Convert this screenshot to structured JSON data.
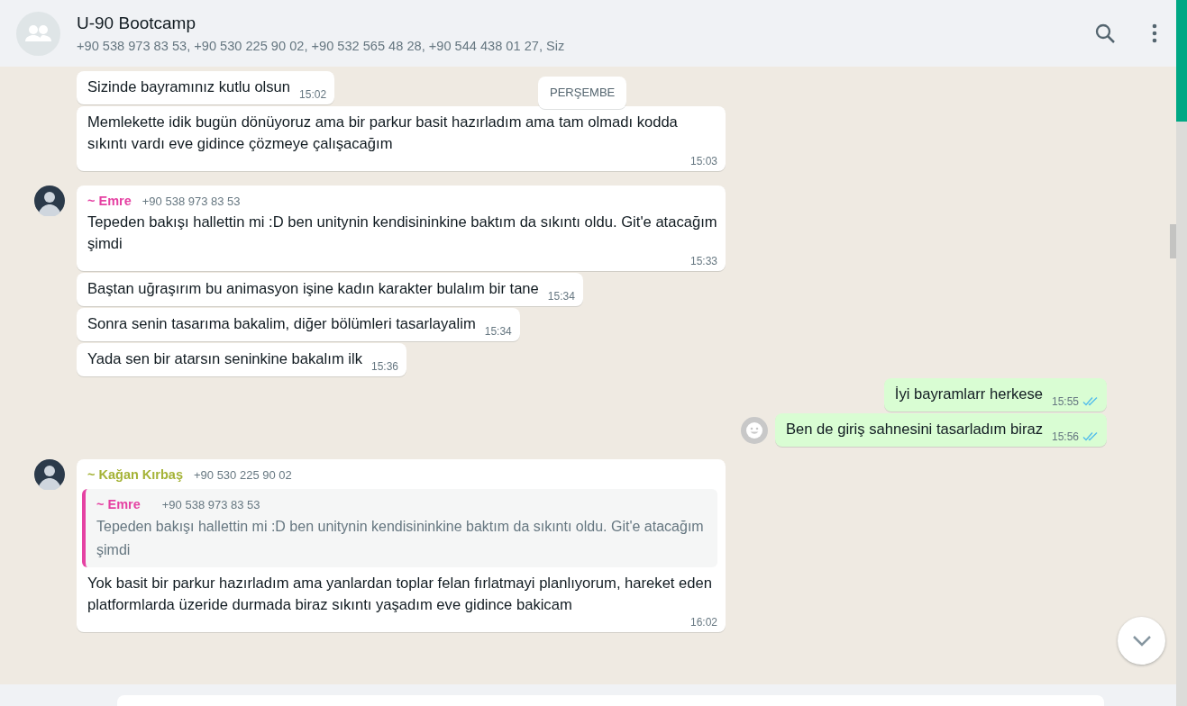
{
  "header": {
    "title": "U-90 Bootcamp",
    "members": "+90 538 973 83 53, +90 530 225 90 02, +90 532 565 48 28, +90 544 438 01 27, Siz"
  },
  "date_chip": "PERŞEMBE",
  "messages": [
    {
      "kind": "in",
      "text": "Sizinde bayramınız kutlu olsun",
      "time": "15:02"
    },
    {
      "kind": "in",
      "text": "Memlekette idik bugün dönüyoruz ama bir parkur basit hazırladım ama tam olmadı kodda sıkıntı vardı eve gidince çözmeye çalışacağım",
      "time": "15:03"
    },
    {
      "kind": "in",
      "sender": "~ Emre",
      "phone": "+90 538 973 83 53",
      "color": "#e542a3",
      "avatar": true,
      "text": "Tepeden bakışı hallettin mi :D ben unitynin kendisininkine baktım da sıkıntı oldu. Git'e atacağım şimdi",
      "time": "15:33"
    },
    {
      "kind": "in",
      "text": "Baştan uğraşırım bu animasyon işine kadın karakter bulalım bir tane",
      "time": "15:34"
    },
    {
      "kind": "in",
      "text": "Sonra senin tasarıma bakalim, diğer bölümleri tasarlayalim",
      "time": "15:34"
    },
    {
      "kind": "in",
      "text": "Yada sen bir atarsın seninkine bakalım ilk",
      "time": "15:36"
    },
    {
      "kind": "out",
      "text": "İyi bayramlarr herkese",
      "time": "15:55",
      "read": true
    },
    {
      "kind": "out",
      "text": "Ben de giriş sahnesini tasarladım biraz",
      "time": "15:56",
      "read": true,
      "reaction_button": true
    },
    {
      "kind": "in",
      "sender": "~ Kağan Kırbaş",
      "phone": "+90 530 225 90 02",
      "color": "#a5b337",
      "avatar": true,
      "quote": {
        "sender": "~ Emre",
        "phone": "+90 538 973 83 53",
        "color": "#e542a3",
        "text": "Tepeden bakışı hallettin mi :D ben unitynin kendisininkine baktım da sıkıntı oldu. Git'e atacağım şimdi"
      },
      "text": "Yok basit bir parkur hazırladım ama yanlardan toplar felan fırlatmayi planlıyorum, hareket eden platformlarda üzeride durmada biraz sıkıntı yaşadım eve gidince bakicam",
      "time": "16:02"
    }
  ]
}
